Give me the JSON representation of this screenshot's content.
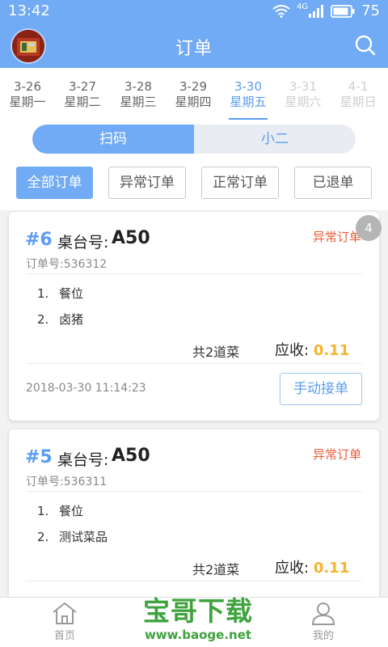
{
  "status_bar": {
    "time": "13:42",
    "network": "4G",
    "battery": "75"
  },
  "header": {
    "title": "订单"
  },
  "dates": [
    {
      "date": "3-26",
      "weekday": "星期一",
      "state": "normal"
    },
    {
      "date": "3-27",
      "weekday": "星期二",
      "state": "normal"
    },
    {
      "date": "3-28",
      "weekday": "星期三",
      "state": "normal"
    },
    {
      "date": "3-29",
      "weekday": "星期四",
      "state": "normal"
    },
    {
      "date": "3-30",
      "weekday": "星期五",
      "state": "active"
    },
    {
      "date": "3-31",
      "weekday": "星期六",
      "state": "disabled"
    },
    {
      "date": "4-1",
      "weekday": "星期日",
      "state": "disabled"
    }
  ],
  "segment": {
    "left": "扫码",
    "right": "小二"
  },
  "filters": [
    "全部订单",
    "异常订单",
    "正常订单",
    "已退单"
  ],
  "orders": [
    {
      "number": "#6",
      "table_label": "桌台号:",
      "table_no": "A50",
      "status": "异常订单",
      "badge": "4",
      "order_id": "订单号:536312",
      "items": [
        {
          "num": "1.",
          "name": "餐位"
        },
        {
          "num": "2.",
          "name": "卤猪"
        }
      ],
      "count": "共2道菜",
      "receivable_label": "应收:",
      "receivable_amount": "0.11",
      "time": "2018-03-30 11:14:23",
      "accept_label": "手动接单"
    },
    {
      "number": "#5",
      "table_label": "桌台号:",
      "table_no": "A50",
      "status": "异常订单",
      "order_id": "订单号:536311",
      "items": [
        {
          "num": "1.",
          "name": "餐位"
        },
        {
          "num": "2.",
          "name": "测试菜品"
        }
      ],
      "count": "共2道菜",
      "receivable_label": "应收:",
      "receivable_amount": "0.11"
    }
  ],
  "nav": {
    "home": "首页",
    "mine": "我的"
  },
  "watermark": {
    "main": "宝哥下载",
    "url": "www.baoge.net"
  },
  "colors": {
    "primary": "#71aaf5",
    "accent": "#5b9cf1",
    "warning": "#ea5c3a",
    "amount": "#f7b32c"
  }
}
